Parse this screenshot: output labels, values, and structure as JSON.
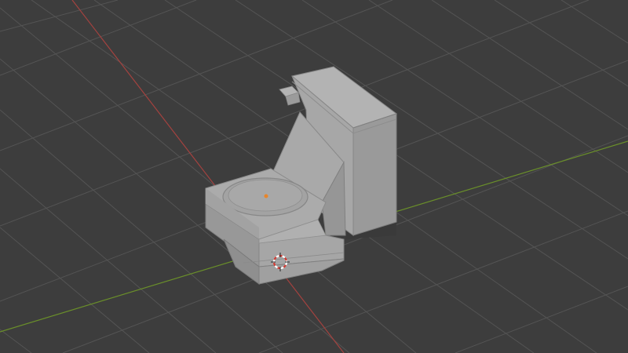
{
  "viewport": {
    "background_color": "#3d3d3d",
    "grid_color": "#545454",
    "x_axis_color": "#a3423f",
    "y_axis_color": "#6a8f2a"
  },
  "scene": {
    "object_name": "toilet-model",
    "object_color": "#9d9d9d",
    "origin_color": "#e8852a",
    "cursor_icon": "3d-cursor-icon"
  }
}
